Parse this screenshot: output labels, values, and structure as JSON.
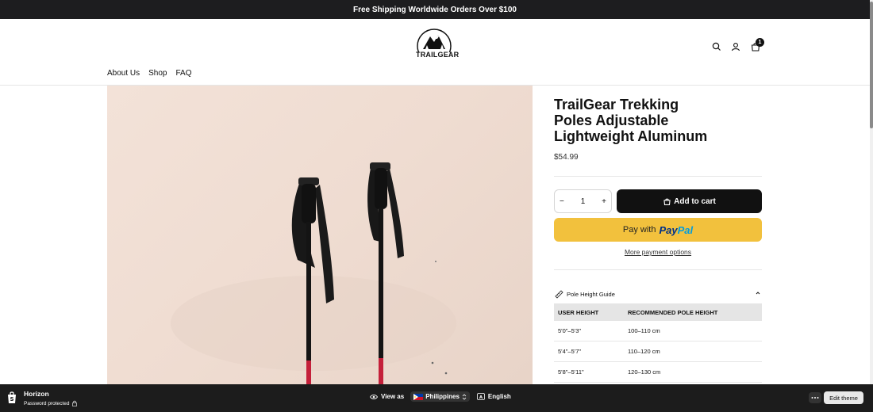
{
  "announcement": "Free Shipping Worldwide Orders Over $100",
  "brand": {
    "logo_text": "TRAILGEAR"
  },
  "header": {
    "icons": [
      "search-icon",
      "account-icon",
      "cart-icon"
    ],
    "cart_count": "1"
  },
  "nav": {
    "items": [
      "About Us",
      "Shop",
      "FAQ"
    ]
  },
  "product": {
    "title": "TrailGear Trekking Poles Adjustable Lightweight Aluminum",
    "price": "$54.99",
    "quantity": "1",
    "qty_minus": "−",
    "qty_plus": "+",
    "add_to_cart": "Add to cart",
    "pay_with": "Pay with",
    "paypal_1": "Pay",
    "paypal_2": "Pal",
    "more_payment": "More payment options"
  },
  "guide": {
    "title": "Pole Height Guide",
    "headers": [
      "USER HEIGHT",
      "RECOMMENDED POLE HEIGHT"
    ],
    "rows": [
      [
        "5'0\"–5'3\"",
        "100–110 cm"
      ],
      [
        "5'4\"–5'7\"",
        "110–120 cm"
      ],
      [
        "5'8\"–5'11\"",
        "120–130 cm"
      ]
    ]
  },
  "admin_bar": {
    "store_name": "Horizon",
    "status": "Password protected",
    "view_as": "View as",
    "country": "Philippines",
    "language": "English",
    "edit_theme": "Edit theme"
  },
  "colors": {
    "accent": "#111111",
    "paypal_yellow": "#f2c13d",
    "bar_bg": "#1c1c1c"
  }
}
